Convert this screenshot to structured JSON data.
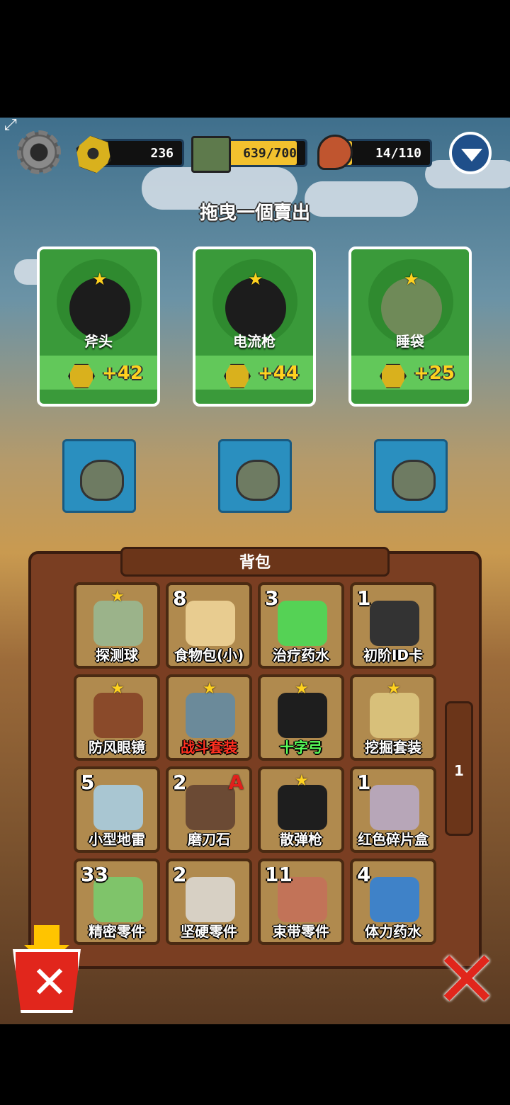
{
  "hud": {
    "nuts": "236",
    "storage": "639/700",
    "stamina": "14/110"
  },
  "title": "拖曳一個賣出",
  "sell_cards": [
    {
      "name": "斧头",
      "price": "+42"
    },
    {
      "name": "电流枪",
      "price": "+44"
    },
    {
      "name": "睡袋",
      "price": "+25"
    }
  ],
  "backpack": {
    "title": "背包",
    "page": "1",
    "items": [
      {
        "name": "探测球",
        "count": "",
        "star": true,
        "color": "#9bb38a"
      },
      {
        "name": "食物包(小)",
        "count": "8",
        "star": false,
        "color": "#e8cc90"
      },
      {
        "name": "治疗药水",
        "count": "3",
        "star": false,
        "color": "#55d255"
      },
      {
        "name": "初阶ID卡",
        "count": "1",
        "star": false,
        "color": "#333333"
      },
      {
        "name": "防风眼镜",
        "count": "",
        "star": true,
        "color": "#8a4a2a"
      },
      {
        "name": "战斗套装",
        "count": "",
        "star": true,
        "color": "#6b8a9a"
      },
      {
        "name": "十字弓",
        "count": "",
        "star": true,
        "color": "#1e1e1e"
      },
      {
        "name": "挖掘套装",
        "count": "",
        "star": true,
        "color": "#d8c07a"
      },
      {
        "name": "小型地雷",
        "count": "5",
        "star": false,
        "color": "#a9c6d2"
      },
      {
        "name": "磨刀石",
        "count": "2",
        "star": false,
        "grade": "A",
        "color": "#6b4a34"
      },
      {
        "name": "散弹枪",
        "count": "",
        "star": true,
        "color": "#1e1e1e"
      },
      {
        "name": "红色碎片盒",
        "count": "1",
        "star": false,
        "color": "#b7a6b8"
      },
      {
        "name": "精密零件",
        "count": "33",
        "star": false,
        "color": "#7fc46a"
      },
      {
        "name": "坚硬零件",
        "count": "2",
        "star": false,
        "color": "#d7d0c4"
      },
      {
        "name": "束带零件",
        "count": "11",
        "star": false,
        "color": "#c27358"
      },
      {
        "name": "体力药水",
        "count": "4",
        "star": false,
        "color": "#3f82c8"
      }
    ]
  }
}
